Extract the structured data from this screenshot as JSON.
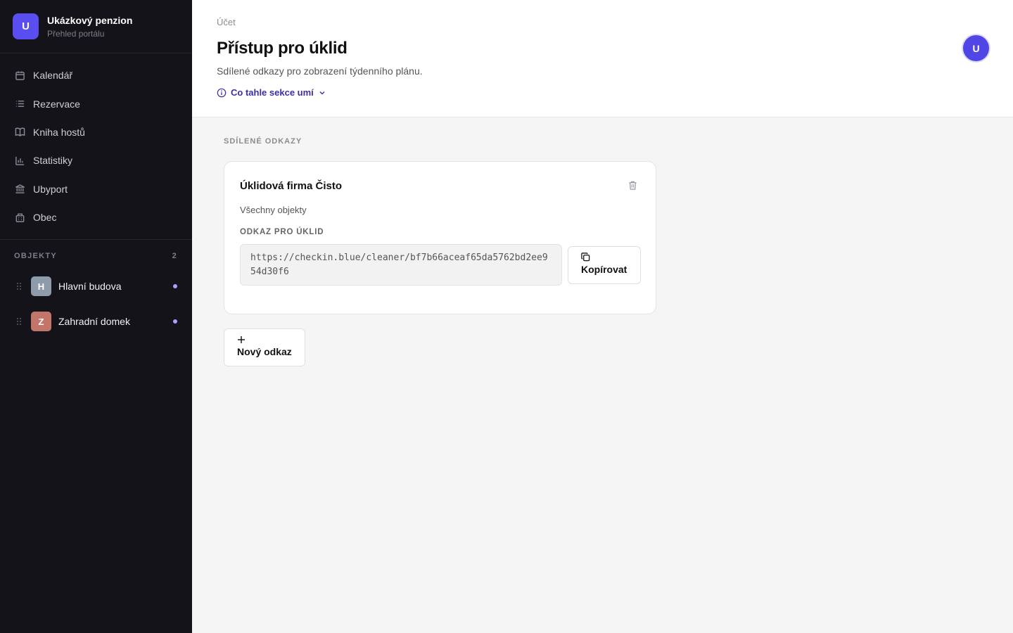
{
  "brand": {
    "initial": "U",
    "name": "Ukázkový penzion",
    "subtitle": "Přehled portálu"
  },
  "nav": [
    {
      "label": "Kalendář",
      "icon": "calendar-icon"
    },
    {
      "label": "Rezervace",
      "icon": "list-icon"
    },
    {
      "label": "Kniha hostů",
      "icon": "book-icon"
    },
    {
      "label": "Statistiky",
      "icon": "bar-chart-icon"
    },
    {
      "label": "Ubyport",
      "icon": "bank-icon"
    },
    {
      "label": "Obec",
      "icon": "building-icon"
    }
  ],
  "objects": {
    "header": "OBJEKTY",
    "count": "2",
    "items": [
      {
        "initial": "H",
        "name": "Hlavní budova",
        "color": "#8e9bab"
      },
      {
        "initial": "Z",
        "name": "Zahradní domek",
        "color": "#c4756a"
      }
    ]
  },
  "header": {
    "breadcrumb": "Účet",
    "title": "Přístup pro úklid",
    "subtitle": "Sdílené odkazy pro zobrazení týdenního plánu.",
    "help_link": "Co tahle sekce umí",
    "user_initial": "U"
  },
  "main": {
    "section_label": "SDÍLENÉ ODKAZY",
    "card": {
      "title": "Úklidová firma Čisto",
      "scope": "Všechny objekty",
      "link_label": "ODKAZ PRO ÚKLID",
      "url": "https://checkin.blue/cleaner/bf7b66aceaf65da5762bd2ee954d30f6",
      "copy_label": "Kopírovat"
    },
    "new_link_label": "Nový odkaz"
  },
  "colors": {
    "accent": "#5b4ef0",
    "sidebar_bg": "#131319",
    "link": "#3b2ea8"
  }
}
